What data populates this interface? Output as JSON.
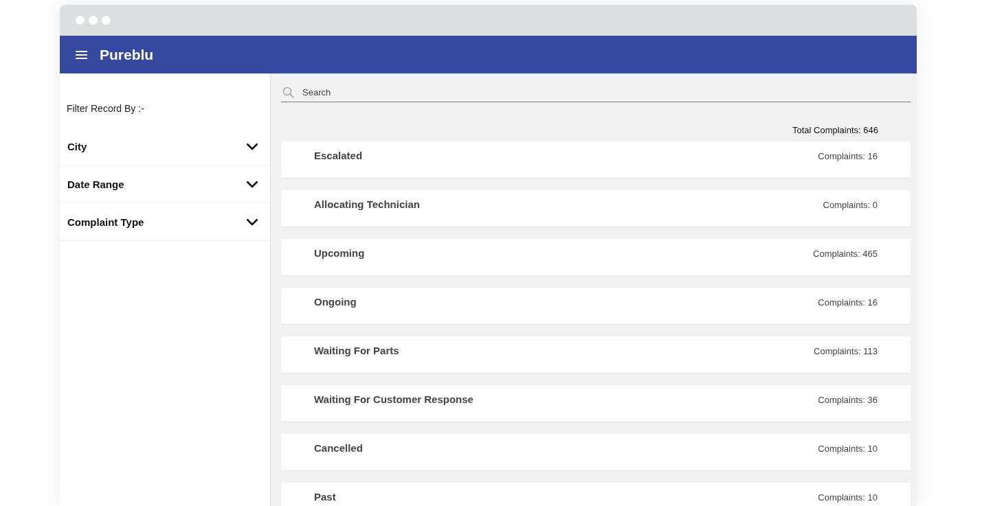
{
  "app": {
    "title": "Pureblu"
  },
  "sidebar": {
    "heading": "Filter Record By :-",
    "filters": [
      {
        "label": "City",
        "expanded": false
      },
      {
        "label": "Date Range",
        "expanded": false
      },
      {
        "label": "Complaint Type",
        "expanded": false
      }
    ]
  },
  "search": {
    "placeholder": "Search"
  },
  "total": "Total Complaints: 646",
  "statuses": [
    {
      "name": "Escalated",
      "count": "Complaints: 16"
    },
    {
      "name": "Allocating Technician",
      "count": "Complaints: 0"
    },
    {
      "name": "Upcoming",
      "count": "Complaints: 465"
    },
    {
      "name": "Ongoing",
      "count": "Complaints: 16"
    },
    {
      "name": "Waiting For Parts",
      "count": "Complaints: 113"
    },
    {
      "name": "Waiting For Customer Response",
      "count": "Complaints: 36"
    },
    {
      "name": "Cancelled",
      "count": "Complaints: 10"
    },
    {
      "name": "Past",
      "count": "Complaints: 10"
    }
  ]
}
